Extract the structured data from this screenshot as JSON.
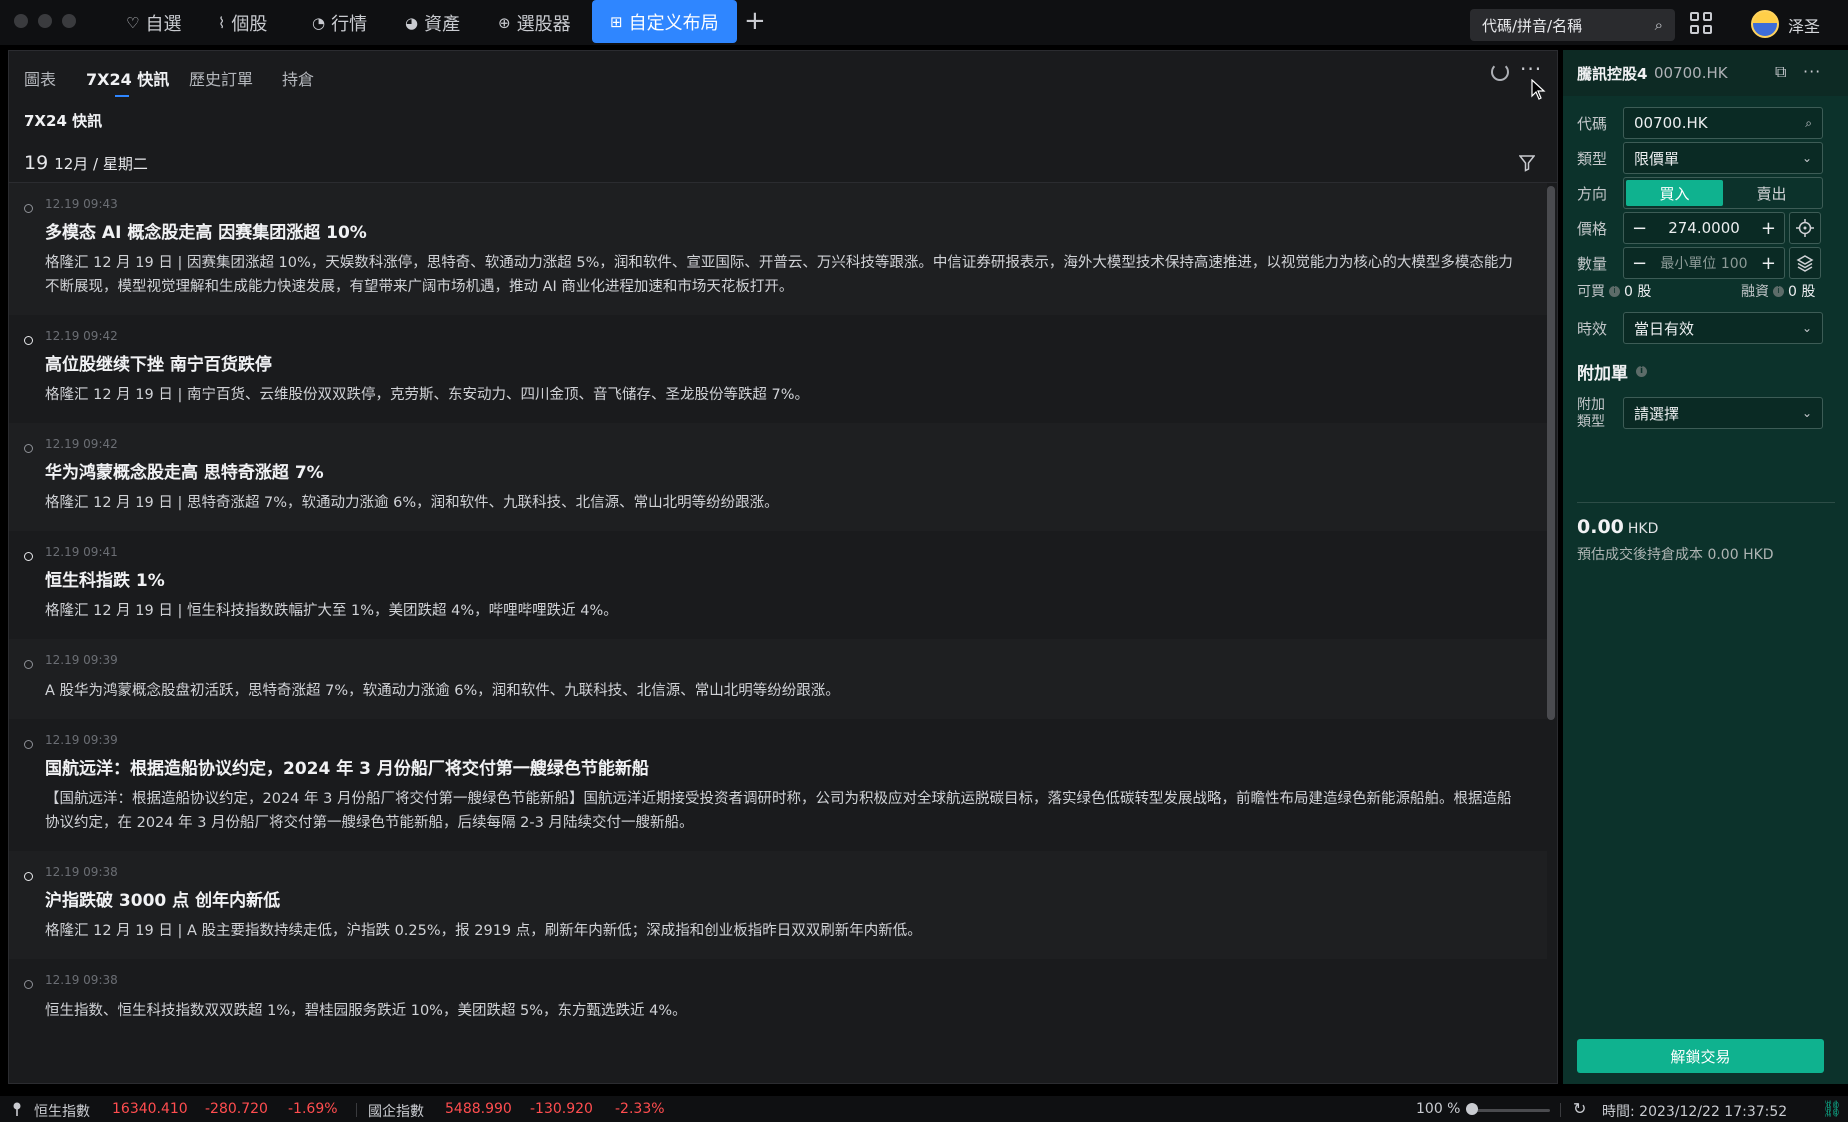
{
  "topbar": {
    "nav": [
      {
        "icon": "heart-icon",
        "glyph": "♡",
        "label": "自選"
      },
      {
        "icon": "chart-icon",
        "glyph": "⌇",
        "label": "個股"
      },
      {
        "icon": "market-icon",
        "glyph": "◔",
        "label": "行情"
      },
      {
        "icon": "pie-icon",
        "glyph": "◕",
        "label": "資產"
      },
      {
        "icon": "screener-icon",
        "glyph": "⊕",
        "label": "選股器"
      },
      {
        "icon": "layout-icon",
        "glyph": "⊞",
        "label": "自定义布局"
      }
    ],
    "add_tab": "+",
    "search_placeholder": "代碼/拼音/名稱",
    "username": "泽圣"
  },
  "main": {
    "tabs": [
      "圖表",
      "7X24 快訊",
      "歷史訂單",
      "持倉"
    ],
    "active_tab": 1,
    "section_title": "7X24 快訊",
    "date_day": "19",
    "date_rest": "12月 / 星期二",
    "news": [
      {
        "time": "12.19 09:43",
        "headline": "多模态 AI 概念股走高 因赛集团涨超 10%",
        "body": "格隆汇 12 月 19 日 | 因赛集团涨超 10%，天娱数科涨停，思特奇、软通动力涨超 5%，润和软件、宣亚国际、开普云、万兴科技等跟涨。中信证券研报表示，海外大模型技术保持高速推进，以视觉能力为核心的大模型多模态能力不断展现，模型视觉理解和生成能力快速发展，有望带来广阔市场机遇，推动 AI 商业化进程加速和市场天花板打开。"
      },
      {
        "time": "12.19 09:42",
        "headline": "高位股继续下挫 南宁百货跌停",
        "body": "格隆汇 12 月 19 日 | 南宁百货、云维股份双双跌停，克劳斯、东安动力、四川金顶、音飞储存、圣龙股份等跌超 7%。"
      },
      {
        "time": "12.19 09:42",
        "headline": "华为鸿蒙概念股走高 思特奇涨超 7%",
        "body": "格隆汇 12 月 19 日 | 思特奇涨超 7%，软通动力涨逾 6%，润和软件、九联科技、北信源、常山北明等纷纷跟涨。"
      },
      {
        "time": "12.19 09:41",
        "headline": "恒生科指跌 1%",
        "body": "格隆汇 12 月 19 日 | 恒生科技指数跌幅扩大至 1%，美团跌超 4%，哔哩哔哩跌近 4%。"
      },
      {
        "time": "12.19 09:39",
        "headline": "",
        "body": "A 股华为鸿蒙概念股盘初活跃，思特奇涨超 7%，软通动力涨逾 6%，润和软件、九联科技、北信源、常山北明等纷纷跟涨。"
      },
      {
        "time": "12.19 09:39",
        "headline": "国航远洋：根据造船协议约定，2024 年 3 月份船厂将交付第一艘绿色节能新船",
        "body": "【国航远洋：根据造船协议约定，2024 年 3 月份船厂将交付第一艘绿色节能新船】国航远洋近期接受投资者调研时称，公司为积极应对全球航运脱碳目标，落实绿色低碳转型发展战略，前瞻性布局建造绿色新能源船舶。根据造船协议约定，在 2024 年 3 月份船厂将交付第一艘绿色节能新船，后续每隔 2-3 月陆续交付一艘新船。"
      },
      {
        "time": "12.19 09:38",
        "headline": "沪指跌破 3000 点 创年内新低",
        "body": "格隆汇 12 月 19 日 | A 股主要指数持续走低，沪指跌 0.25%，报 2919 点，刷新年内新低；深成指和创业板指昨日双双刷新年内新低。"
      },
      {
        "time": "12.19 09:38",
        "headline": "",
        "body": "恒生指数、恒生科技指数双双跌超 1%，碧桂园服务跌近 10%，美团跌超 5%，东方甄选跌近 4%。"
      }
    ]
  },
  "panel": {
    "title": "騰訊控股4",
    "code": "00700.HK",
    "labels": {
      "code": "代碼",
      "type": "類型",
      "direction": "方向",
      "price": "價格",
      "qty": "數量",
      "validity": "時效",
      "addon_type": "附加類型"
    },
    "code_value": "00700.HK",
    "type_value": "限價單",
    "buy": "買入",
    "sell": "賣出",
    "price_value": "274.0000",
    "qty_placeholder": "最小單位 100",
    "minus": "−",
    "plus": "+",
    "can_buy_label": "可買",
    "can_buy_value": "0 股",
    "margin_label": "融資",
    "margin_value": "0 股",
    "validity_value": "當日有效",
    "addon_title": "附加單",
    "addon_value": "請選擇",
    "amount": "0.00",
    "currency": "HKD",
    "cost_text": "預估成交後持倉成本 0.00 HKD",
    "unlock": "解鎖交易"
  },
  "statusbar": {
    "idx1_name": "恒生指數",
    "idx1_price": "16340.410",
    "idx1_change": "-280.720",
    "idx1_pct": "-1.69%",
    "idx2_name": "國企指數",
    "idx2_price": "5488.990",
    "idx2_change": "-130.920",
    "idx2_pct": "-2.33%",
    "zoom": "100 %",
    "time": "時間: 2023/12/22 17:37:52"
  },
  "colors": {
    "accent": "#2f86ff",
    "buy": "#0fb28f",
    "down": "#ff4d4f",
    "panel_bg": "#0c322b"
  }
}
